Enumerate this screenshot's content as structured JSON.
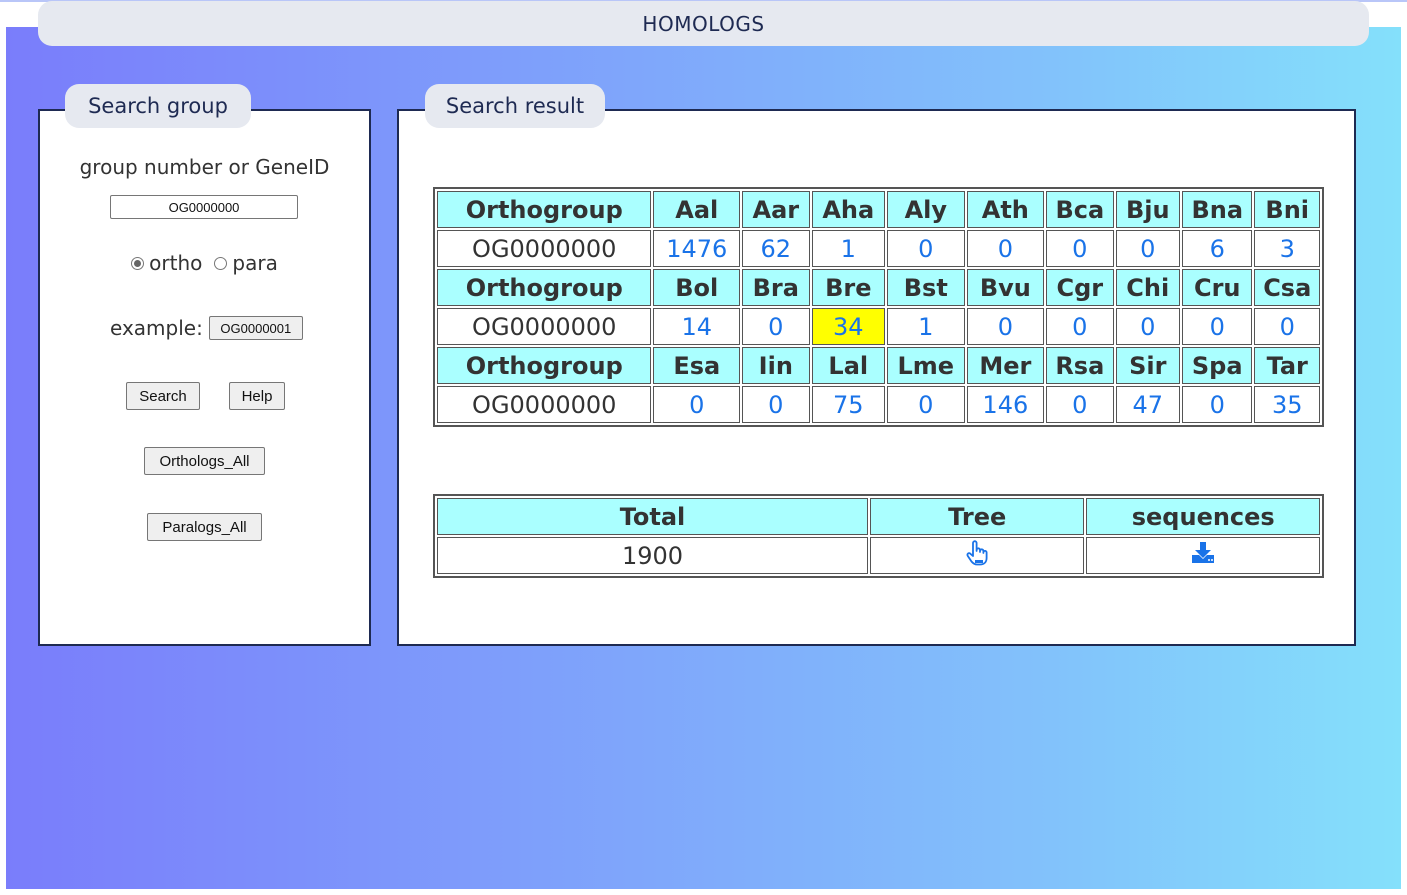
{
  "header": {
    "title": "HOMOLOGS"
  },
  "search_panel": {
    "tab_label": "Search group",
    "field_label": "group number or GeneID",
    "input_value": "OG0000000",
    "radio_ortho": "ortho",
    "radio_para": "para",
    "selected": "ortho",
    "example_label": "example:",
    "example_button": "OG0000001",
    "search_button": "Search",
    "help_button": "Help",
    "orthologs_all_button": "Orthologs_All",
    "paralogs_all_button": "Paralogs_All"
  },
  "result_panel": {
    "tab_label": "Search result",
    "blocks": [
      {
        "header_label": "Orthogroup",
        "species": [
          "Aal",
          "Aar",
          "Aha",
          "Aly",
          "Ath",
          "Bca",
          "Bju",
          "Bna",
          "Bni"
        ],
        "group": "OG0000000",
        "values": [
          "1476",
          "62",
          "1",
          "0",
          "0",
          "0",
          "0",
          "6",
          "3"
        ]
      },
      {
        "header_label": "Orthogroup",
        "species": [
          "Bol",
          "Bra",
          "Bre",
          "Bst",
          "Bvu",
          "Cgr",
          "Chi",
          "Cru",
          "Csa"
        ],
        "group": "OG0000000",
        "values": [
          "14",
          "0",
          "34",
          "1",
          "0",
          "0",
          "0",
          "0",
          "0"
        ]
      },
      {
        "header_label": "Orthogroup",
        "species": [
          "Esa",
          "Iin",
          "Lal",
          "Lme",
          "Mer",
          "Rsa",
          "Sir",
          "Spa",
          "Tar"
        ],
        "group": "OG0000000",
        "values": [
          "0",
          "0",
          "75",
          "0",
          "146",
          "0",
          "47",
          "0",
          "35"
        ]
      }
    ],
    "highlight_color": "#ffff00",
    "summary": {
      "total_label": "Total",
      "tree_label": "Tree",
      "sequences_label": "sequences",
      "total_value": "1900",
      "tree_icon": "pointer-hand-icon",
      "sequences_icon": "download-icon"
    }
  }
}
